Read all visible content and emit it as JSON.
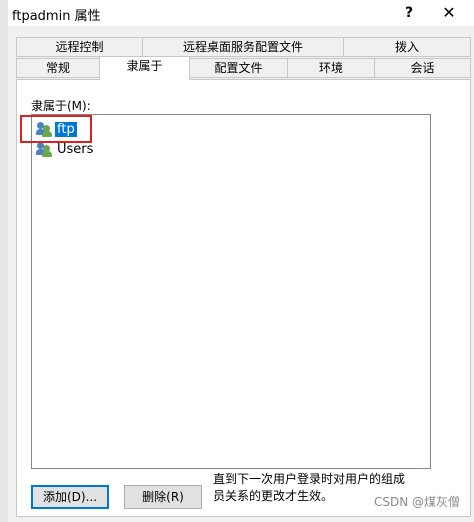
{
  "window": {
    "title": "ftpadmin 属性",
    "help_glyph": "?",
    "close_glyph": "✕"
  },
  "tabs": {
    "row1": [
      "远程控制",
      "远程桌面服务配置文件",
      "拨入"
    ],
    "row2": [
      "常规",
      "隶属于",
      "配置文件",
      "环境",
      "会话"
    ],
    "active": "隶属于"
  },
  "member_of": {
    "label": "隶属于(M):",
    "items": [
      {
        "name": "ftp",
        "selected": true,
        "icon": "group-icon"
      },
      {
        "name": "Users",
        "selected": false,
        "icon": "group-icon"
      }
    ]
  },
  "buttons": {
    "add": "添加(D)...",
    "remove": "删除(R)"
  },
  "note": "直到下一次用户登录时对用户的组成员关系的更改才生效。",
  "watermark": "CSDN @煤灰僧",
  "colors": {
    "selection": "#0078d7",
    "highlight_annotation": "#e02020"
  }
}
